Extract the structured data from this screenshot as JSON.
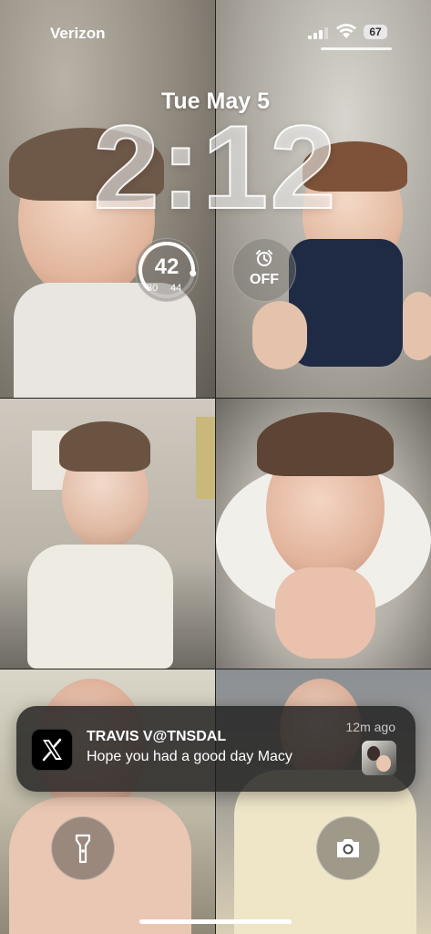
{
  "status_bar": {
    "carrier": "Verizon",
    "battery": "67",
    "icons": [
      "cellular-signal-icon",
      "wifi-icon",
      "battery-icon"
    ]
  },
  "lock_screen": {
    "date": "Tue May 5",
    "time": "2:12"
  },
  "widgets": {
    "weather": {
      "temp": "42",
      "low": "30",
      "high": "44",
      "level": 0.86
    },
    "alarm": {
      "icon": "alarm-clock-icon",
      "status": "OFF"
    }
  },
  "notification": {
    "app_icon": "x-logo-icon",
    "sender": "TRAVIS V@TNSDAL",
    "message": "Hope you had a good day Macy",
    "time": "12m ago"
  },
  "quick_actions": {
    "left": "flashlight-icon",
    "right": "camera-icon"
  },
  "colors": {
    "notification_bg": "#1e1e1e",
    "text": "#ffffff",
    "secondary_text": "#c8c8c8"
  }
}
